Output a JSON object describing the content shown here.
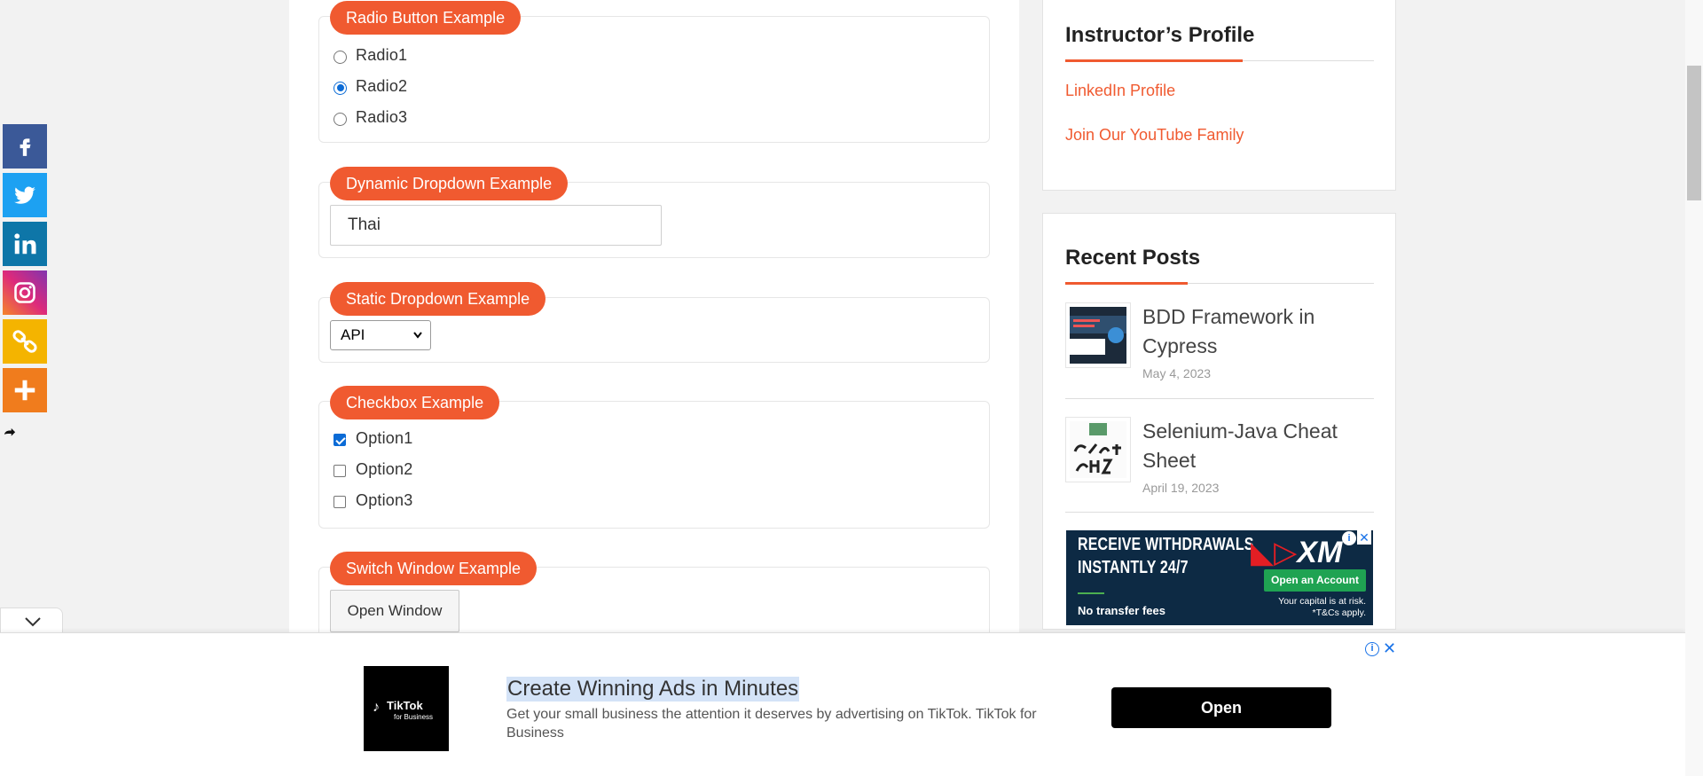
{
  "sections": {
    "radio": {
      "legend": "Radio Button Example",
      "options": [
        "Radio1",
        "Radio2",
        "Radio3"
      ],
      "selected": "Radio2"
    },
    "dynamic_dropdown": {
      "legend": "Dynamic Dropdown Example",
      "value": "Thai"
    },
    "static_dropdown": {
      "legend": "Static Dropdown Example",
      "selected": "API"
    },
    "checkbox": {
      "legend": "Checkbox Example",
      "options": [
        "Option1",
        "Option2",
        "Option3"
      ],
      "checked": [
        "Option1"
      ]
    },
    "switch_window": {
      "legend": "Switch Window Example",
      "button": "Open Window"
    }
  },
  "sidebar": {
    "profile": {
      "title": "Instructor’s Profile",
      "links": [
        "LinkedIn Profile",
        "Join Our YouTube Family"
      ]
    },
    "recent_posts": {
      "title": "Recent Posts",
      "posts": [
        {
          "title": "BDD Framework in Cypress",
          "date": "May 4, 2023"
        },
        {
          "title": "Selenium-Java Cheat Sheet",
          "date": "April 19, 2023"
        }
      ]
    },
    "ad": {
      "headline_1": "RECEIVE WITHDRAWALS",
      "headline_2": "INSTANTLY 24/7",
      "subline": "No transfer fees",
      "button": "Open an Account",
      "risk_1": "Your capital is at risk.",
      "risk_2": "*T&Cs apply."
    }
  },
  "social": {
    "items": [
      "facebook-icon",
      "twitter-icon",
      "linkedin-icon",
      "instagram-icon",
      "copy-link-icon",
      "more-icon"
    ],
    "colors": {
      "facebook": "#3b5998",
      "twitter": "#1da1f2",
      "linkedin": "#0e76a8",
      "instagram": "#e1306c",
      "copy": "#f4b400",
      "more": "#f07c1d"
    }
  },
  "bottom_ad": {
    "headline": "Create Winning Ads in Minutes",
    "body": "Get your small business the attention it deserves by advertising on TikTok. TikTok for Business",
    "button": "Open",
    "logo_line1": "TikTok",
    "logo_line2": "for Business"
  },
  "theme": {
    "accent": "#f05a30",
    "checked_blue": "#0b6bd6"
  }
}
